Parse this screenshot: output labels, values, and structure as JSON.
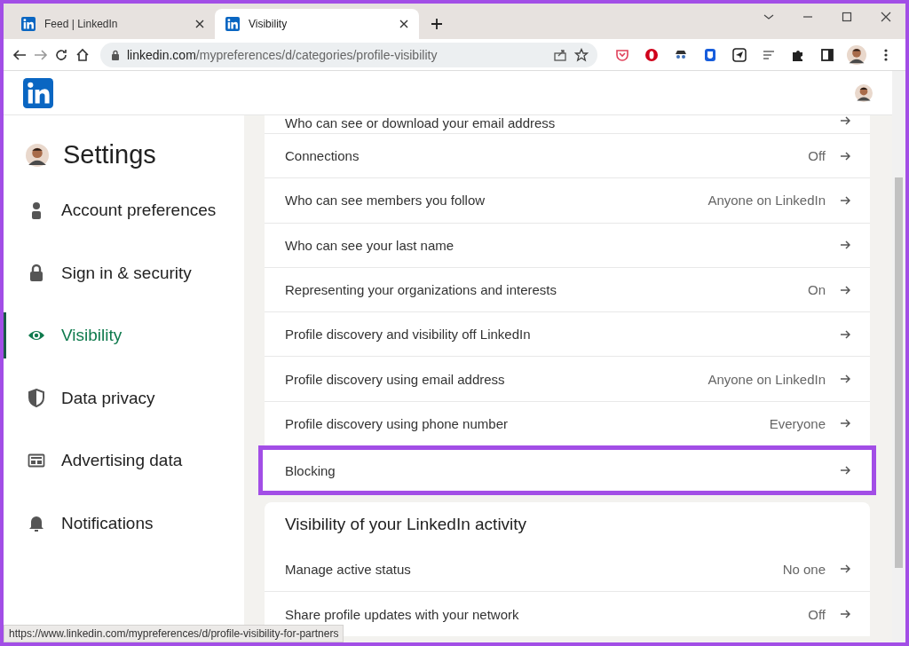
{
  "browser": {
    "tabs": [
      {
        "title": "Feed | LinkedIn",
        "selected": false
      },
      {
        "title": "Visibility",
        "selected": true
      }
    ],
    "address_host": "linkedin.com",
    "address_path": "/mypreferences/d/categories/profile-visibility"
  },
  "sidebar": {
    "title": "Settings",
    "items": [
      {
        "label": "Account preferences",
        "kind": "person",
        "selected": false
      },
      {
        "label": "Sign in & security",
        "kind": "lock",
        "selected": false
      },
      {
        "label": "Visibility",
        "kind": "eye",
        "selected": true
      },
      {
        "label": "Data privacy",
        "kind": "shield",
        "selected": false
      },
      {
        "label": "Advertising data",
        "kind": "ad",
        "selected": false
      },
      {
        "label": "Notifications",
        "kind": "bell",
        "selected": false
      }
    ]
  },
  "cards": [
    {
      "rows": [
        {
          "label": "Who can see or download your email address",
          "highlighted": false
        },
        {
          "label": "Connections",
          "value": "Off",
          "highlighted": false
        },
        {
          "label": "Who can see members you follow",
          "value": "Anyone on LinkedIn",
          "highlighted": false
        },
        {
          "label": "Who can see your last name",
          "highlighted": false
        },
        {
          "label": "Representing your organizations and interests",
          "value": "On",
          "highlighted": false
        },
        {
          "label": "Profile discovery and visibility off LinkedIn",
          "highlighted": false
        },
        {
          "label": "Profile discovery using email address",
          "value": "Anyone on LinkedIn",
          "highlighted": false
        },
        {
          "label": "Profile discovery using phone number",
          "value": "Everyone",
          "highlighted": false
        },
        {
          "label": "Blocking",
          "highlighted": true
        }
      ]
    },
    {
      "heading": "Visibility of your LinkedIn activity",
      "rows": [
        {
          "label": "Manage active status",
          "value": "No one",
          "highlighted": false
        },
        {
          "label": "Share profile updates with your network",
          "value": "Off",
          "highlighted": false
        }
      ]
    }
  ],
  "status_url": "https://www.linkedin.com/mypreferences/d/profile-visibility-for-partners"
}
